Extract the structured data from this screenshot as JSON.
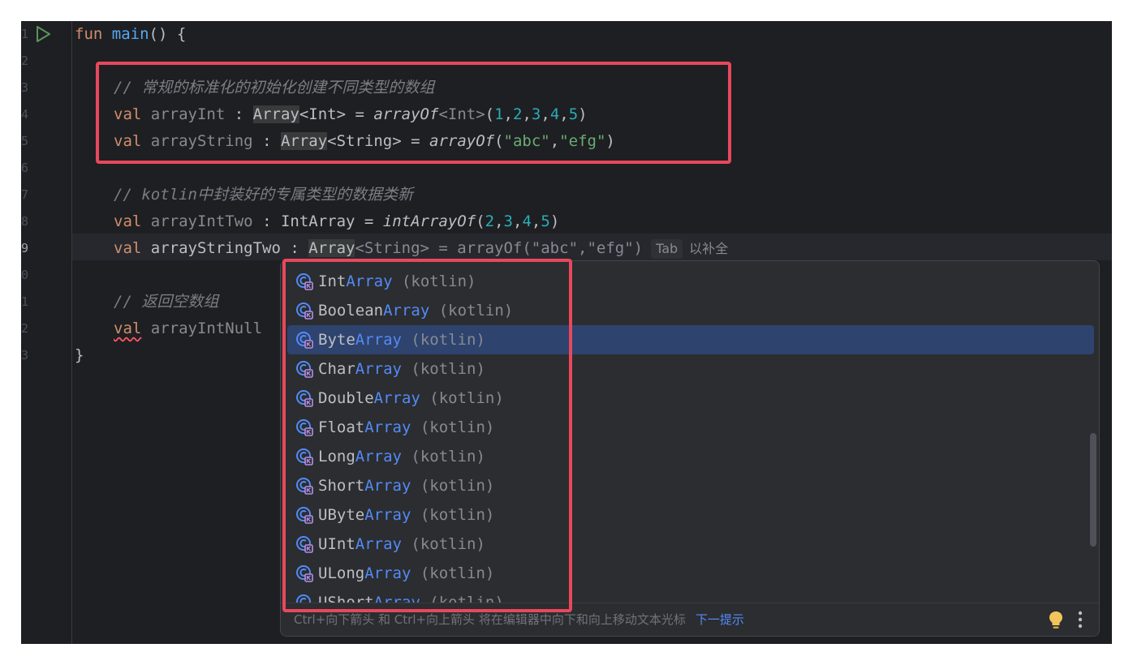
{
  "gutter": {
    "line_numbers": [
      "1",
      "2",
      "3",
      "4",
      "5",
      "6",
      "7",
      "8",
      "9",
      "0",
      "1",
      "2",
      "3"
    ]
  },
  "code": {
    "l1": {
      "kw": "fun",
      "name": "main",
      "rest": "() {"
    },
    "l3": {
      "comment": "// 常规的标准化的初始化创建不同类型的数组"
    },
    "l4": {
      "kw": "val",
      "name": "arrayInt",
      "colon": " : ",
      "type": "Array",
      "generic": "<Int>",
      "eq": " = ",
      "fn": "arrayOf",
      "tparam": "<Int>",
      "open": "(",
      "n1": "1",
      "c1": ",",
      "n2": "2",
      "c2": ",",
      "n3": "3",
      "c3": ",",
      "n4": "4",
      "c4": ",",
      "n5": "5",
      "close": ")"
    },
    "l5": {
      "kw": "val",
      "name": "arrayString",
      "colon": " : ",
      "type": "Array",
      "generic": "<String>",
      "eq": " = ",
      "fn": "arrayOf",
      "open": "(",
      "s1": "\"abc\"",
      "c1": ",",
      "s2": "\"efg\"",
      "close": ")"
    },
    "l7": {
      "comment": "// kotlin中封装好的专属类型的数据类新"
    },
    "l8": {
      "kw": "val",
      "name": "arrayIntTwo",
      "colon": " : ",
      "type": "IntArray",
      "eq": " = ",
      "fn": "intArrayOf",
      "open": "(",
      "n1": "2",
      "c1": ",",
      "n2": "3",
      "c2": ",",
      "n3": "4",
      "c3": ",",
      "n4": "5",
      "close": ")"
    },
    "l9": {
      "kw": "val",
      "name": "arrayStringTwo",
      "colon": " : ",
      "type": "Array",
      "ghost": "<String> = arrayOf(\"abc\",\"efg\")",
      "tab_key": "Tab",
      "tab_hint": "以补全"
    },
    "l11": {
      "comment": "// 返回空数组"
    },
    "l12": {
      "kw": "val",
      "name": "arrayIntNull"
    },
    "l13": {
      "brace": "}"
    }
  },
  "completion": {
    "items": [
      {
        "prefix": "Int",
        "match": "Array",
        "pkg": " (kotlin)",
        "icon": "class-icon"
      },
      {
        "prefix": "Boolean",
        "match": "Array",
        "pkg": " (kotlin)",
        "icon": "class-icon"
      },
      {
        "prefix": "Byte",
        "match": "Array",
        "pkg": " (kotlin)",
        "icon": "class-icon"
      },
      {
        "prefix": "Char",
        "match": "Array",
        "pkg": " (kotlin)",
        "icon": "class-icon"
      },
      {
        "prefix": "Double",
        "match": "Array",
        "pkg": " (kotlin)",
        "icon": "class-icon"
      },
      {
        "prefix": "Float",
        "match": "Array",
        "pkg": " (kotlin)",
        "icon": "class-icon"
      },
      {
        "prefix": "Long",
        "match": "Array",
        "pkg": " (kotlin)",
        "icon": "class-icon"
      },
      {
        "prefix": "Short",
        "match": "Array",
        "pkg": " (kotlin)",
        "icon": "class-icon"
      },
      {
        "prefix": "UByte",
        "match": "Array",
        "pkg": " (kotlin)",
        "icon": "class-icon"
      },
      {
        "prefix": "UInt",
        "match": "Array",
        "pkg": " (kotlin)",
        "icon": "class-icon"
      },
      {
        "prefix": "ULong",
        "match": "Array",
        "pkg": " (kotlin)",
        "icon": "class-icon"
      },
      {
        "prefix": "UShort",
        "match": "Array",
        "pkg": " (kotlin)",
        "icon": "class-icon"
      }
    ],
    "selected_item": "ByteArray",
    "footer_hint": "Ctrl+向下箭头 和 Ctrl+向上箭头 将在编辑器中向下和向上移动文本光标",
    "footer_link": "下一提示"
  },
  "colors": {
    "editor_bg": "#1e1f22",
    "popup_bg": "#2b2d30",
    "selection": "#2e436e",
    "annotation_red": "#e8485c",
    "keyword": "#cf8e6d",
    "match": "#548af7"
  }
}
